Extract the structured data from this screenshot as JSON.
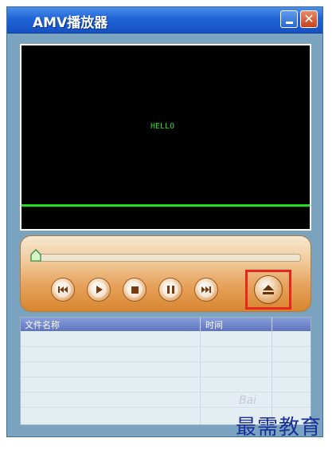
{
  "window": {
    "title": "AMV播放器"
  },
  "video": {
    "overlay_text": "HELLO"
  },
  "controls": {
    "seek_progress": 0,
    "buttons": [
      {
        "name": "previous-button",
        "icon": "skip-back-icon"
      },
      {
        "name": "play-button",
        "icon": "play-icon"
      },
      {
        "name": "stop-button",
        "icon": "stop-icon"
      },
      {
        "name": "pause-button",
        "icon": "pause-icon"
      },
      {
        "name": "next-button",
        "icon": "skip-forward-icon"
      }
    ],
    "eject": {
      "name": "eject-button",
      "icon": "eject-icon"
    },
    "highlight_color": "#e8261e"
  },
  "playlist": {
    "columns": [
      "文件名称",
      "时间"
    ],
    "rows": []
  },
  "watermark": {
    "text": "最需教育",
    "brand": "Bai"
  }
}
